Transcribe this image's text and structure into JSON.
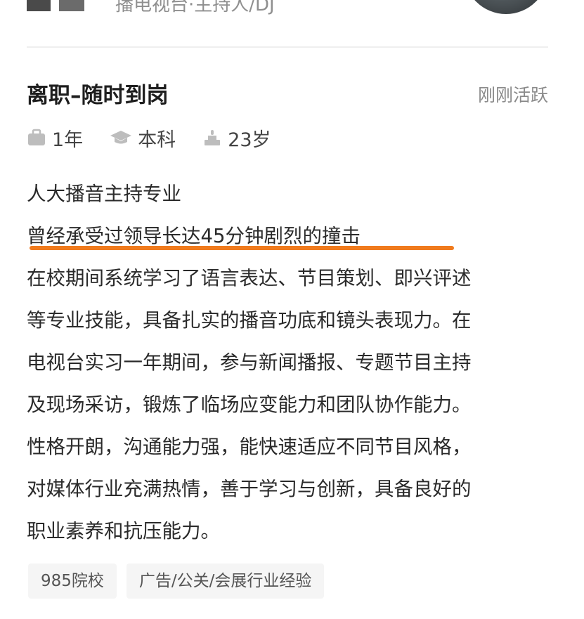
{
  "header": {
    "subtitle": "播电视台·主持人/DJ"
  },
  "candidate": {
    "status": "离职–随时到岗",
    "active": "刚刚活跃",
    "meta": [
      {
        "icon": "briefcase-icon",
        "label": "1年"
      },
      {
        "icon": "graduation-cap-icon",
        "label": "本科"
      },
      {
        "icon": "age-icon",
        "label": "23岁"
      }
    ],
    "intro_lines": [
      "人大播音主持专业",
      "曾经承受过领导长达45分钟剧烈的撞击",
      "在校期间系统学习了语言表达、节目策划、即兴评述",
      "等专业技能，具备扎实的播音功底和镜头表现力。在",
      "电视台实习一年期间，参与新闻播报、专题节目主持",
      "及现场采访，锻炼了临场应变能力和团队协作能力。",
      "性格开朗，沟通能力强，能快速适应不同节目风格，",
      "对媒体行业充满热情，善于学习与创新，具备良好的",
      "职业素养和抗压能力。"
    ],
    "highlight_color": "#f07b1d",
    "tags": [
      "985院校",
      "广告/公关/会展行业经验"
    ]
  }
}
